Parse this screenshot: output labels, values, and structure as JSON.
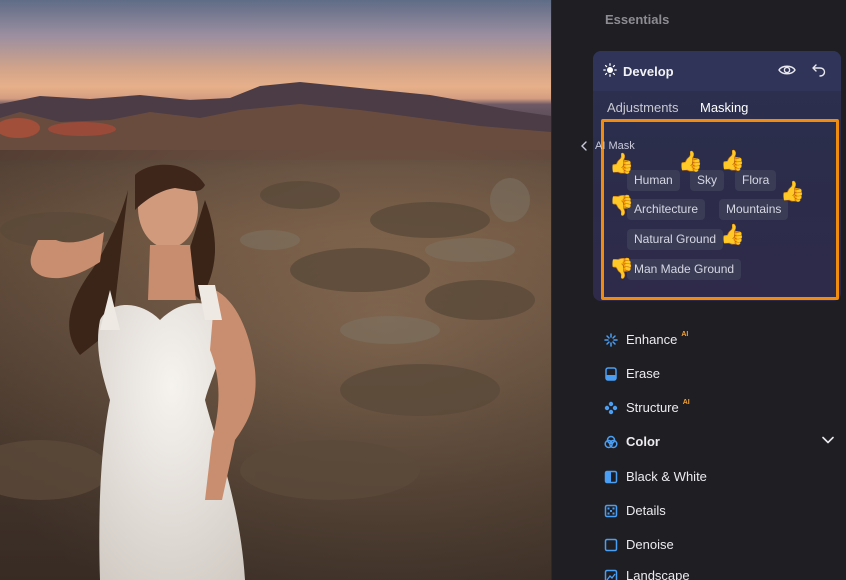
{
  "panel": {
    "section_title": "Essentials",
    "develop": {
      "title": "Develop",
      "tabs": [
        {
          "label": "Adjustments",
          "active": false
        },
        {
          "label": "Masking",
          "active": true
        }
      ],
      "ai_mask": {
        "back_label": "AI Mask",
        "chips": [
          "Human",
          "Sky",
          "Flora",
          "Architecture",
          "Mountains",
          "Natural Ground",
          "Man Made Ground"
        ],
        "annotations": {
          "Human": "thumbs-up",
          "Sky": "thumbs-up",
          "Flora": "thumbs-up",
          "Architecture": "thumbs-down",
          "Mountains": "thumbs-up",
          "Natural Ground": "thumbs-up",
          "Man Made Ground": "thumbs-down"
        },
        "highlight_color": "#f28c0f"
      }
    },
    "tools": [
      {
        "label": "Enhance",
        "ai": "AI",
        "icon": "enhance-icon"
      },
      {
        "label": "Erase",
        "ai": "",
        "icon": "erase-icon"
      },
      {
        "label": "Structure",
        "ai": "AI",
        "icon": "structure-icon"
      },
      {
        "label": "Color",
        "ai": "",
        "icon": "color-icon",
        "expandable": true
      },
      {
        "label": "Black & White",
        "ai": "",
        "icon": "black-white-icon"
      },
      {
        "label": "Details",
        "ai": "",
        "icon": "details-icon"
      },
      {
        "label": "Denoise",
        "ai": "",
        "icon": "denoise-icon"
      },
      {
        "label": "Landscape",
        "ai": "",
        "icon": "landscape-icon"
      }
    ],
    "accent_color": "#4a9ff5"
  }
}
